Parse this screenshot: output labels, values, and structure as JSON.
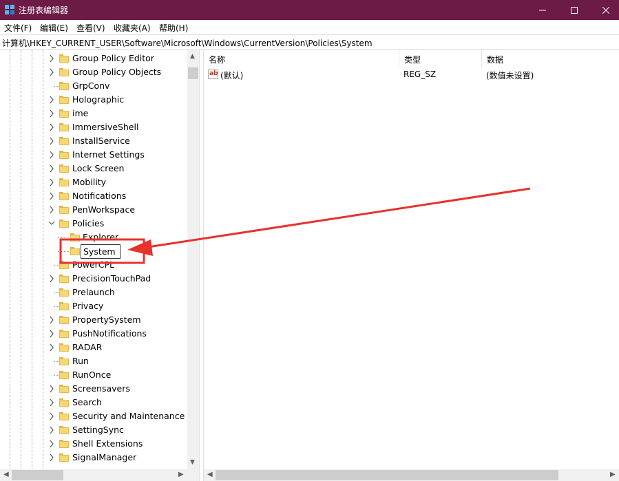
{
  "window": {
    "title": "注册表编辑器",
    "title_bar_color": "#6b1b45"
  },
  "menu": {
    "file": "文件(F)",
    "edit": "编辑(E)",
    "view": "查看(V)",
    "favorites": "收藏夹(A)",
    "help": "帮助(H)"
  },
  "address": {
    "path": "计算机\\HKEY_CURRENT_USER\\Software\\Microsoft\\Windows\\CurrentVersion\\Policies\\System"
  },
  "tree": {
    "items": [
      {
        "label": "Group Policy Editor",
        "expander": "collapsed"
      },
      {
        "label": "Group Policy Objects",
        "expander": "collapsed"
      },
      {
        "label": "GrpConv",
        "expander": "none"
      },
      {
        "label": "Holographic",
        "expander": "collapsed"
      },
      {
        "label": "ime",
        "expander": "collapsed"
      },
      {
        "label": "ImmersiveShell",
        "expander": "collapsed"
      },
      {
        "label": "InstallService",
        "expander": "collapsed"
      },
      {
        "label": "Internet Settings",
        "expander": "collapsed"
      },
      {
        "label": "Lock Screen",
        "expander": "collapsed"
      },
      {
        "label": "Mobility",
        "expander": "collapsed"
      },
      {
        "label": "Notifications",
        "expander": "collapsed"
      },
      {
        "label": "PenWorkspace",
        "expander": "collapsed"
      },
      {
        "label": "Policies",
        "expander": "expanded"
      },
      {
        "label": "Explorer",
        "expander": "child"
      },
      {
        "label": "System",
        "expander": "editing"
      },
      {
        "label": "PowerCPL",
        "expander": "none"
      },
      {
        "label": "PrecisionTouchPad",
        "expander": "collapsed"
      },
      {
        "label": "Prelaunch",
        "expander": "none"
      },
      {
        "label": "Privacy",
        "expander": "none"
      },
      {
        "label": "PropertySystem",
        "expander": "collapsed"
      },
      {
        "label": "PushNotifications",
        "expander": "collapsed"
      },
      {
        "label": "RADAR",
        "expander": "collapsed"
      },
      {
        "label": "Run",
        "expander": "none"
      },
      {
        "label": "RunOnce",
        "expander": "none"
      },
      {
        "label": "Screensavers",
        "expander": "collapsed"
      },
      {
        "label": "Search",
        "expander": "collapsed"
      },
      {
        "label": "Security and Maintenance",
        "expander": "collapsed"
      },
      {
        "label": "SettingSync",
        "expander": "collapsed"
      },
      {
        "label": "Shell Extensions",
        "expander": "collapsed"
      },
      {
        "label": "SignalManager",
        "expander": "collapsed"
      }
    ]
  },
  "list": {
    "headers": {
      "name": "名称",
      "type": "类型",
      "data": "数据"
    },
    "rows": [
      {
        "icon": "ab",
        "name": "(默认)",
        "type": "REG_SZ",
        "data": "(数值未设置)"
      }
    ]
  },
  "annotation": {
    "color": "#e8322c"
  }
}
